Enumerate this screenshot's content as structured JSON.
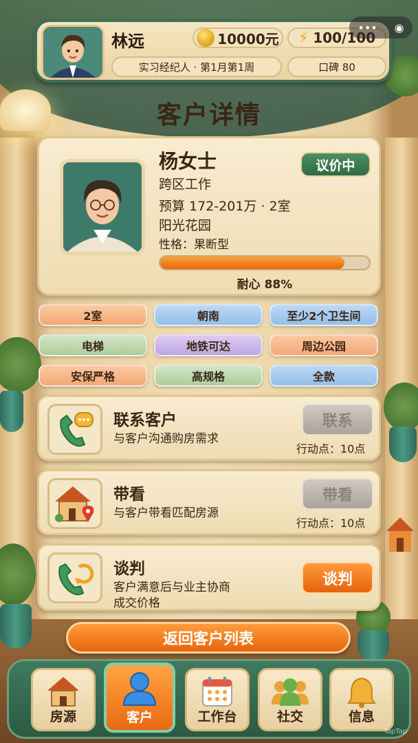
{
  "player": {
    "name": "林远",
    "coins": "10000元",
    "energy": "100/100",
    "rank_date": "实习经纪人 · 第1月第1周",
    "reputation": "口碑 80"
  },
  "mini_program": {
    "more": "•••",
    "close": "◉"
  },
  "page_title": "客户详情",
  "client": {
    "name": "杨女士",
    "status": "议价中",
    "work": "跨区工作",
    "budget": "预算 172-201万 · 2室",
    "area": "阳光花园",
    "personality": "性格：果断型",
    "patience_percent": 88,
    "patience_label": "耐心 88%"
  },
  "tags": [
    {
      "label": "2室",
      "color": "orange"
    },
    {
      "label": "朝南",
      "color": "blue"
    },
    {
      "label": "至少2个卫生间",
      "color": "blue"
    },
    {
      "label": "电梯",
      "color": "green"
    },
    {
      "label": "地铁可达",
      "color": "purple"
    },
    {
      "label": "周边公园",
      "color": "orange"
    },
    {
      "label": "安保严格",
      "color": "orange"
    },
    {
      "label": "高规格",
      "color": "green"
    },
    {
      "label": "全款",
      "color": "blue"
    }
  ],
  "actions": [
    {
      "title": "联系客户",
      "desc": "与客户沟通购房需求",
      "button": "联系",
      "cost": "行动点：10点",
      "enabled": false,
      "icon": "phone-chat-icon"
    },
    {
      "title": "带看",
      "desc": "与客户带看匹配房源",
      "button": "带看",
      "cost": "行动点：10点",
      "enabled": false,
      "icon": "house-location-icon"
    },
    {
      "title": "谈判",
      "desc": "客户满意后与业主协商成交价格",
      "button": "谈判",
      "cost": "",
      "enabled": true,
      "icon": "phone-cycle-icon"
    }
  ],
  "return_button": "返回客户列表",
  "nav": [
    {
      "label": "房源",
      "icon": "house-icon",
      "active": false
    },
    {
      "label": "客户",
      "icon": "person-icon",
      "active": true
    },
    {
      "label": "工作台",
      "icon": "calendar-icon",
      "active": false
    },
    {
      "label": "社交",
      "icon": "group-icon",
      "active": false
    },
    {
      "label": "信息",
      "icon": "bell-icon",
      "active": false
    }
  ],
  "watermark": "TapTap"
}
